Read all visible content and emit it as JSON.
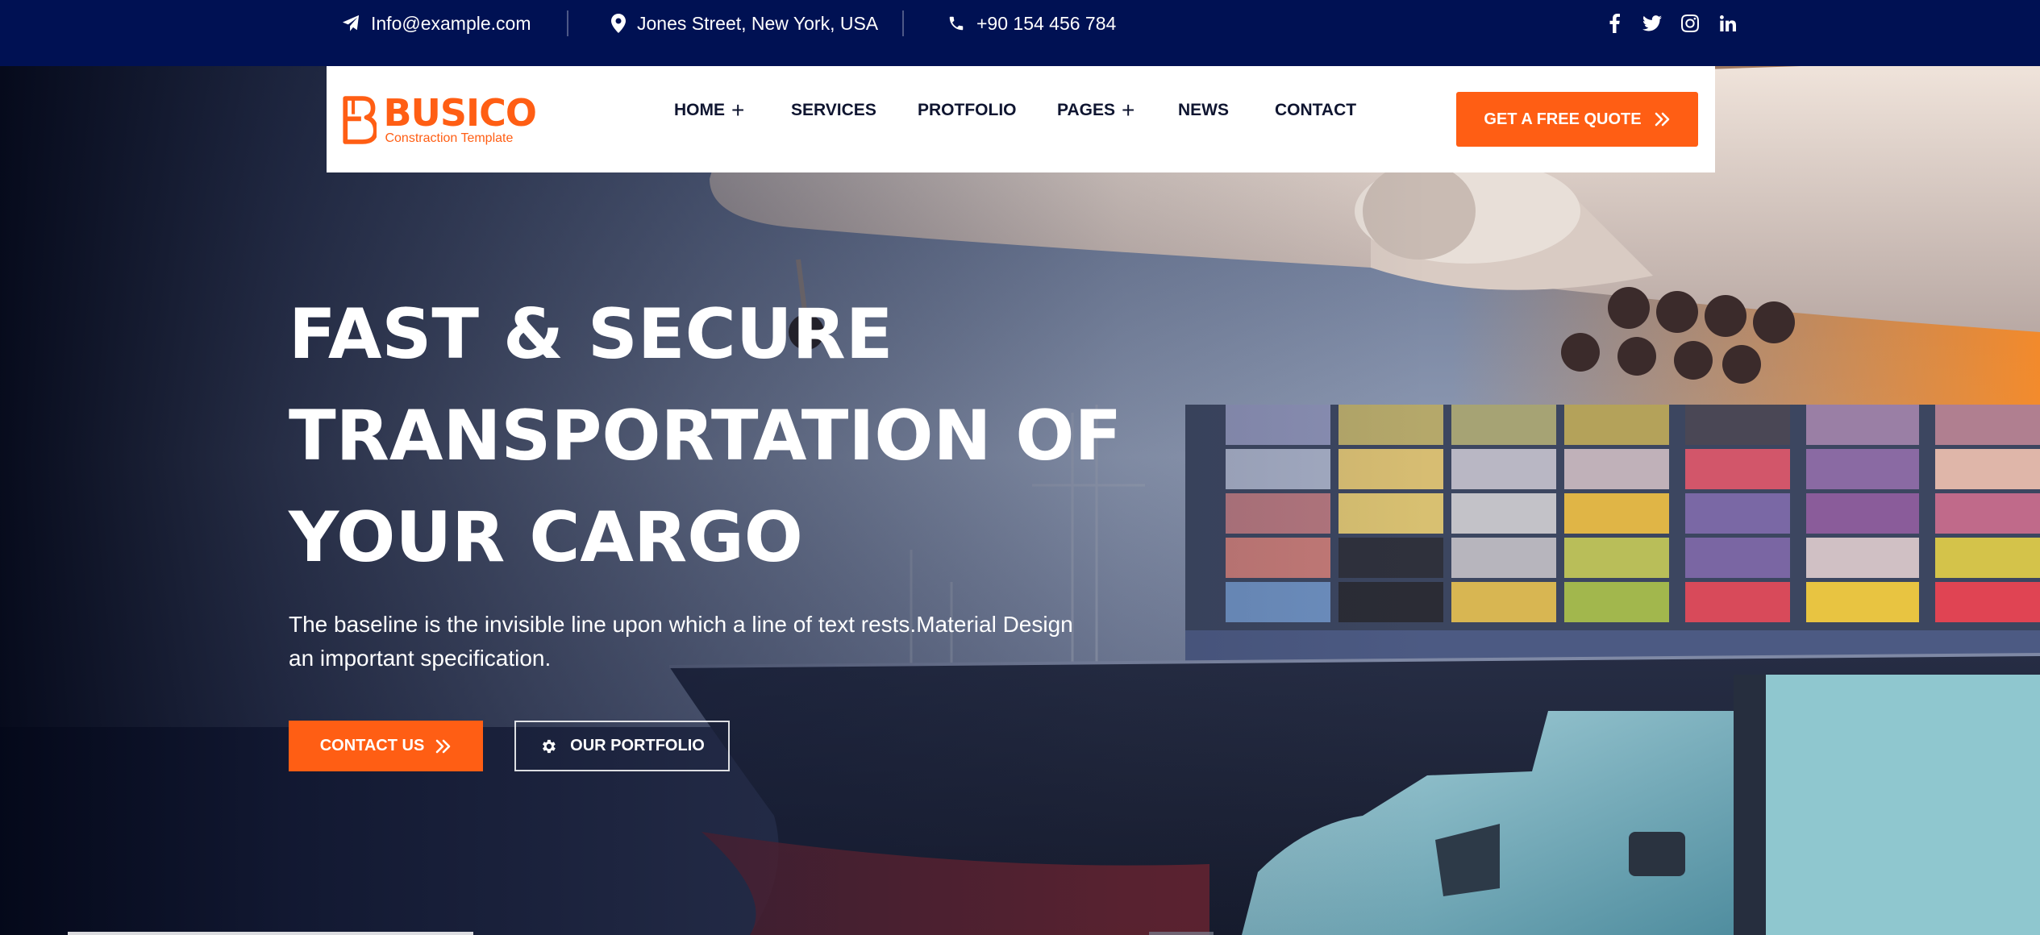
{
  "topbar": {
    "email": "Info@example.com",
    "address": "Jones Street, New York, USA",
    "phone": "+90 154 456 784",
    "social": [
      "facebook-icon",
      "twitter-icon",
      "instagram-icon",
      "linkedin-icon"
    ]
  },
  "brand": {
    "name": "BUSICO",
    "tagline": "Constraction Template",
    "accent_color": "#ff5e14",
    "dark_color": "#001153"
  },
  "nav": {
    "items": [
      {
        "label": "HOME",
        "has_submenu": true
      },
      {
        "label": "SERVICES",
        "has_submenu": false
      },
      {
        "label": "PROTFOLIO",
        "has_submenu": false
      },
      {
        "label": "PAGES",
        "has_submenu": true
      },
      {
        "label": "NEWS",
        "has_submenu": false
      },
      {
        "label": "CONTACT",
        "has_submenu": false
      }
    ],
    "submenu_symbol": "+",
    "cta_label": "GET A FREE QUOTE"
  },
  "hero": {
    "title_lines": [
      "FAST & SECURE",
      "TRANSPORTATION OF",
      "YOUR CARGO"
    ],
    "description": "The baseline is the invisible line upon which a line of text rests.Material Design an important specification.",
    "primary_button": "CONTACT US",
    "secondary_button": "OUR PORTFOLIO"
  }
}
